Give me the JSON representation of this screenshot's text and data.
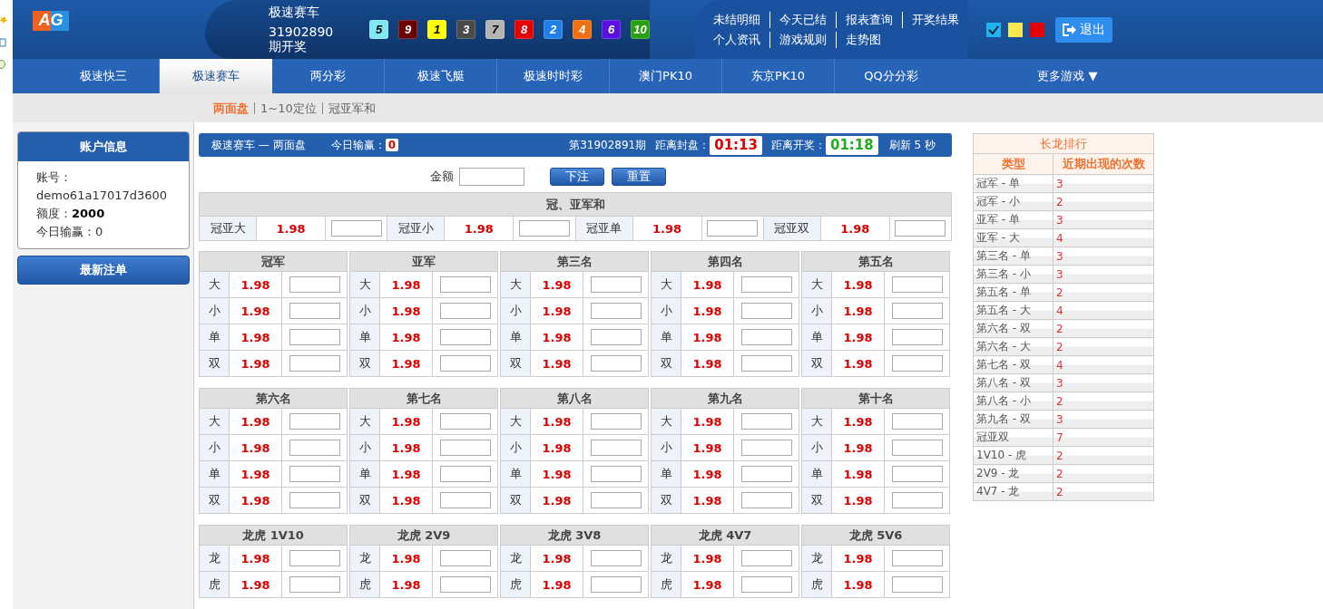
{
  "header": {
    "logo": "AG",
    "game_name": "极速赛车",
    "issue": "31902890 期开奖",
    "balls": [
      {
        "number": "5",
        "color": "#7fe8f2"
      },
      {
        "number": "9",
        "color": "#6b0000"
      },
      {
        "number": "1",
        "color": "#ffff00"
      },
      {
        "number": "3",
        "color": "#4a4a4a"
      },
      {
        "number": "7",
        "color": "#b4b4b4"
      },
      {
        "number": "8",
        "color": "#e60000"
      },
      {
        "number": "2",
        "color": "#1e7fe6"
      },
      {
        "number": "4",
        "color": "#f07010"
      },
      {
        "number": "6",
        "color": "#5a10e0"
      },
      {
        "number": "10",
        "color": "#2aa010"
      }
    ],
    "links": [
      [
        "未结明细",
        "今天已结",
        "报表查询",
        "开奖结果"
      ],
      [
        "个人资讯",
        "游戏规则",
        "走势图"
      ]
    ],
    "theme_swatches": [
      {
        "color": "#1eb4f0",
        "selected": true
      },
      {
        "color": "#f8e850",
        "selected": false
      },
      {
        "color": "#e60000",
        "selected": false
      }
    ],
    "logout": "退出"
  },
  "nav": {
    "tabs": [
      {
        "label": "极速快三",
        "selected": false
      },
      {
        "label": "极速赛车",
        "selected": true
      },
      {
        "label": "两分彩",
        "selected": false
      },
      {
        "label": "极速飞艇",
        "selected": false
      },
      {
        "label": "极速时时彩",
        "selected": false
      },
      {
        "label": "澳门PK10",
        "selected": false
      },
      {
        "label": "东京PK10",
        "selected": false
      },
      {
        "label": "QQ分分彩",
        "selected": false
      }
    ],
    "more": "更多游戏",
    "more_arrow": "▼"
  },
  "subnav": [
    {
      "label": "两面盘",
      "selected": true
    },
    {
      "label": "1~10定位",
      "selected": false
    },
    {
      "label": "冠亚军和",
      "selected": false
    }
  ],
  "account": {
    "title": "账户信息",
    "account_label": "账号：",
    "account": "demo61a17017d3600",
    "credit_label": "额度：",
    "credit": "2000",
    "today_label": "今日输赢：0",
    "latest_bets": "最新注单"
  },
  "info_bar": {
    "title": "极速赛车 — 两面盘",
    "today_label": "今日输赢：",
    "today_value": "0",
    "period": "第31902891期",
    "close_label": "距离封盘：",
    "close_time": "01:13",
    "draw_label": "距离开奖：",
    "draw_time": "01:18",
    "refresh": "刷新 5 秒"
  },
  "bet_form": {
    "amount_label": "金额",
    "submit": "下注",
    "reset": "重置"
  },
  "sum_section": {
    "title": "冠、亚军和",
    "items": [
      {
        "label": "冠亚大",
        "odds": "1.98"
      },
      {
        "label": "冠亚小",
        "odds": "1.98"
      },
      {
        "label": "冠亚单",
        "odds": "1.98"
      },
      {
        "label": "冠亚双",
        "odds": "1.98"
      }
    ]
  },
  "groups": [
    {
      "title": "冠军",
      "items": [
        {
          "label": "大",
          "odds": "1.98"
        },
        {
          "label": "小",
          "odds": "1.98"
        },
        {
          "label": "单",
          "odds": "1.98"
        },
        {
          "label": "双",
          "odds": "1.98"
        }
      ]
    },
    {
      "title": "亚军",
      "items": [
        {
          "label": "大",
          "odds": "1.98"
        },
        {
          "label": "小",
          "odds": "1.98"
        },
        {
          "label": "单",
          "odds": "1.98"
        },
        {
          "label": "双",
          "odds": "1.98"
        }
      ]
    },
    {
      "title": "第三名",
      "items": [
        {
          "label": "大",
          "odds": "1.98"
        },
        {
          "label": "小",
          "odds": "1.98"
        },
        {
          "label": "单",
          "odds": "1.98"
        },
        {
          "label": "双",
          "odds": "1.98"
        }
      ]
    },
    {
      "title": "第四名",
      "items": [
        {
          "label": "大",
          "odds": "1.98"
        },
        {
          "label": "小",
          "odds": "1.98"
        },
        {
          "label": "单",
          "odds": "1.98"
        },
        {
          "label": "双",
          "odds": "1.98"
        }
      ]
    },
    {
      "title": "第五名",
      "items": [
        {
          "label": "大",
          "odds": "1.98"
        },
        {
          "label": "小",
          "odds": "1.98"
        },
        {
          "label": "单",
          "odds": "1.98"
        },
        {
          "label": "双",
          "odds": "1.98"
        }
      ]
    },
    {
      "title": "第六名",
      "items": [
        {
          "label": "大",
          "odds": "1.98"
        },
        {
          "label": "小",
          "odds": "1.98"
        },
        {
          "label": "单",
          "odds": "1.98"
        },
        {
          "label": "双",
          "odds": "1.98"
        }
      ]
    },
    {
      "title": "第七名",
      "items": [
        {
          "label": "大",
          "odds": "1.98"
        },
        {
          "label": "小",
          "odds": "1.98"
        },
        {
          "label": "单",
          "odds": "1.98"
        },
        {
          "label": "双",
          "odds": "1.98"
        }
      ]
    },
    {
      "title": "第八名",
      "items": [
        {
          "label": "大",
          "odds": "1.98"
        },
        {
          "label": "小",
          "odds": "1.98"
        },
        {
          "label": "单",
          "odds": "1.98"
        },
        {
          "label": "双",
          "odds": "1.98"
        }
      ]
    },
    {
      "title": "第九名",
      "items": [
        {
          "label": "大",
          "odds": "1.98"
        },
        {
          "label": "小",
          "odds": "1.98"
        },
        {
          "label": "单",
          "odds": "1.98"
        },
        {
          "label": "双",
          "odds": "1.98"
        }
      ]
    },
    {
      "title": "第十名",
      "items": [
        {
          "label": "大",
          "odds": "1.98"
        },
        {
          "label": "小",
          "odds": "1.98"
        },
        {
          "label": "单",
          "odds": "1.98"
        },
        {
          "label": "双",
          "odds": "1.98"
        }
      ]
    },
    {
      "title": "龙虎 1V10",
      "items": [
        {
          "label": "龙",
          "odds": "1.98"
        },
        {
          "label": "虎",
          "odds": "1.98"
        }
      ]
    },
    {
      "title": "龙虎 2V9",
      "items": [
        {
          "label": "龙",
          "odds": "1.98"
        },
        {
          "label": "虎",
          "odds": "1.98"
        }
      ]
    },
    {
      "title": "龙虎 3V8",
      "items": [
        {
          "label": "龙",
          "odds": "1.98"
        },
        {
          "label": "虎",
          "odds": "1.98"
        }
      ]
    },
    {
      "title": "龙虎 4V7",
      "items": [
        {
          "label": "龙",
          "odds": "1.98"
        },
        {
          "label": "虎",
          "odds": "1.98"
        }
      ]
    },
    {
      "title": "龙虎 5V6",
      "items": [
        {
          "label": "龙",
          "odds": "1.98"
        },
        {
          "label": "虎",
          "odds": "1.98"
        }
      ]
    }
  ],
  "streak_ranking": {
    "title": "长龙排行",
    "columns": [
      "类型",
      "近期出现的次数"
    ],
    "rows": [
      [
        "冠军 - 单",
        "3"
      ],
      [
        "冠军 - 小",
        "2"
      ],
      [
        "亚军 - 单",
        "3"
      ],
      [
        "亚军 - 大",
        "4"
      ],
      [
        "第三名 - 单",
        "3"
      ],
      [
        "第三名 - 小",
        "3"
      ],
      [
        "第五名 - 单",
        "2"
      ],
      [
        "第五名 - 大",
        "4"
      ],
      [
        "第六名 - 双",
        "2"
      ],
      [
        "第六名 - 大",
        "2"
      ],
      [
        "第七名 - 双",
        "4"
      ],
      [
        "第八名 - 双",
        "3"
      ],
      [
        "第八名 - 小",
        "2"
      ],
      [
        "第九名 - 双",
        "3"
      ],
      [
        "冠亚双",
        "7"
      ],
      [
        "1V10 - 虎",
        "2"
      ],
      [
        "2V9 - 龙",
        "2"
      ],
      [
        "4V7 - 龙",
        "2"
      ]
    ]
  }
}
